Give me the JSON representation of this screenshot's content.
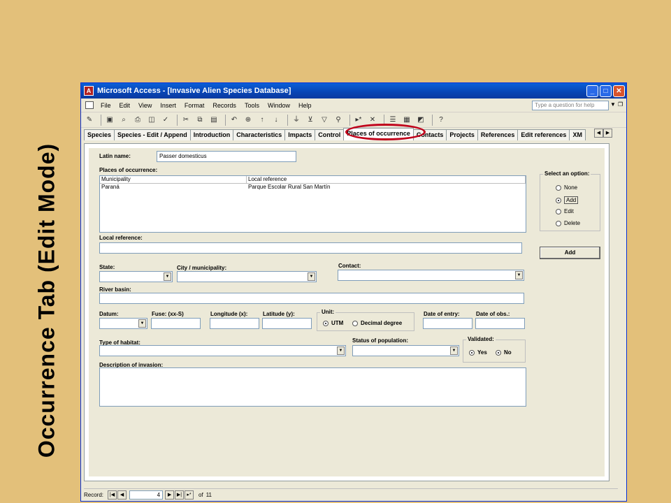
{
  "slide_title": "Occurrence Tab (Edit Mode)",
  "window": {
    "title": "Microsoft Access - [Invasive Alien Species Database]",
    "buttons": {
      "minimize": "_",
      "maximize": "□",
      "close": "✕"
    }
  },
  "menu": {
    "items": [
      "File",
      "Edit",
      "View",
      "Insert",
      "Format",
      "Records",
      "Tools",
      "Window",
      "Help"
    ],
    "help_placeholder": "Type a question for help"
  },
  "toolbar_icons": [
    "design-view-icon",
    "save-icon",
    "search-icon",
    "print-icon",
    "print-preview-icon",
    "spelling-icon",
    "cut-icon",
    "copy-icon",
    "paste-icon",
    "undo-icon",
    "hyperlink-icon",
    "sort-asc-icon",
    "sort-desc-icon",
    "filter-selection-icon",
    "filter-form-icon",
    "apply-filter-icon",
    "find-icon",
    "new-record-icon",
    "delete-record-icon",
    "properties-icon",
    "database-window-icon",
    "new-object-icon",
    "help-icon"
  ],
  "tabs": [
    "Species",
    "Species - Edit / Append",
    "Introduction",
    "Characteristics",
    "Impacts",
    "Control",
    "Places of occurrence",
    "Contacts",
    "Projects",
    "References",
    "Edit references",
    "XM"
  ],
  "active_tab": "Places of occurrence",
  "form": {
    "latin_name_label": "Latin name:",
    "latin_name_value": "Passer domesticus",
    "places_label": "Places of occurrence:",
    "grid_headers": [
      "Municipality",
      "Local reference"
    ],
    "grid_rows": [
      [
        "Paraná",
        "Parque Escolar Rural San Martín"
      ]
    ],
    "select_option_title": "Select an option:",
    "options": [
      "None",
      "Add",
      "Edit",
      "Delete"
    ],
    "selected_option": "Add",
    "add_button": "Add",
    "local_reference_label": "Local reference:",
    "state_label": "State:",
    "city_label": "City / municipality:",
    "contact_label": "Contact:",
    "river_basin_label": "River basin:",
    "datum_label": "Datum:",
    "fuse_label": "Fuse: (xx-S)",
    "longitude_label": "Longitude  (x):",
    "latitude_label": "Latitude (y):",
    "unit_title": "Unit:",
    "unit_utm": "UTM",
    "unit_decimal": "Decimal degree",
    "date_entry_label": "Date of entry:",
    "date_obs_label": "Date of obs.:",
    "habitat_label": "Type of habitat:",
    "population_label": "Status of population:",
    "validated_title": "Validated:",
    "validated_yes": "Yes",
    "validated_no": "No",
    "description_label": "Description of invasion:"
  },
  "navbar": {
    "record_label": "Record:",
    "current_record": "4",
    "of_text": "of",
    "total_records": "11"
  }
}
